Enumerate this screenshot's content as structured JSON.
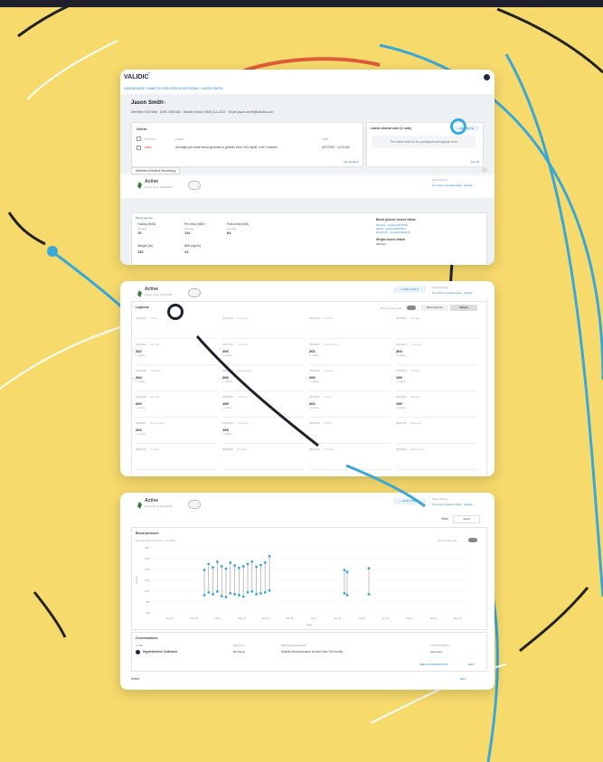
{
  "app": {
    "logo": "VALIDIC",
    "breadcrumb": "DASHBOARD  /  DIABETES-RELATED MONITORING  /  JASON SMITH"
  },
  "patient": {
    "name": "Jason Smith",
    "details": "Identifier 0007698  ·  DOB 3/5/1960  ·  Mobile phone (555) 111-2222  ·  Email jason.smith@validic.com"
  },
  "alerts": {
    "title": "Alerts",
    "col_status": "STATUS",
    "col_alert": "ALERT",
    "col_time": "TIME",
    "row_badge": "HIGH",
    "row_text": "Average pre-meal blood glucose is greater than 130 mg/dL over 3 weeks",
    "row_time": "4/27/2023 · 10:24 AM",
    "link": "See all alerts"
  },
  "latest_note": {
    "title": "Latest clinical note (1 note)",
    "add_label": "+ ADD NOTE",
    "placeholder": "The latest note for the participant will appear here.",
    "link": "See all"
  },
  "program": {
    "tab": "Diabetes-Related Monitoring",
    "status": "Active",
    "since": "Active since 10/4/2022",
    "data_sharing": "Data sharing",
    "data_sharing_link": "5 months of patient data · change",
    "add_vitals": "+ ADD VITALS",
    "colors": {
      "active": "#2e7d32",
      "accent": "#1f87c7",
      "alert": "#d9534f"
    }
  },
  "glucose": {
    "section": "Blood glucose",
    "fasting_label": "Fasting (4MD)",
    "premeal_label": "Pre-meal (4MD)",
    "postmeal_label": "Post-meal (4MD)",
    "fasting_val": "78",
    "premeal_val": "110",
    "postmeal_val": "84",
    "avg_label": "Average",
    "weight_title": "Weight (lb)",
    "bmi_title": "BMI (kg/m²)",
    "weight_val": "152",
    "bmi_val": "24",
    "source_title": "Blood glucose source status",
    "source_1": "Dexcom  ·  synced 4/27/2023",
    "source_2": "Abbott  ·  synced 4/25/2023",
    "source_3": "OneTouch  ·  synced 4/22/2023",
    "weight_source_title": "Weight source status",
    "weight_source": "Withings"
  },
  "logbook": {
    "title": "Logbook",
    "toggle_label": "Out of range only",
    "btn_1": "Blood glucose",
    "btn_2": "Weight",
    "days": [
      {
        "date": "04/12/23",
        "day": "Friday",
        "val": "",
        "note": ""
      },
      {
        "date": "04/13/23",
        "day": "Saturday",
        "val": "",
        "note": ""
      },
      {
        "date": "04/14/23",
        "day": "Sunday",
        "val": "",
        "note": ""
      },
      {
        "date": "04/15/23",
        "day": "Monday",
        "val": "",
        "note": ""
      },
      {
        "date": "04/16/23",
        "day": "Monday",
        "val": "202",
        "note": "1 reading"
      },
      {
        "date": "04/17/23",
        "day": "Tuesday",
        "val": "206",
        "note": "1 reading"
      },
      {
        "date": "04/18/23",
        "day": "Wednesday",
        "val": "201",
        "note": "1 reading"
      },
      {
        "date": "04/19/23",
        "day": "Thursday",
        "val": "203",
        "note": "1 reading"
      },
      {
        "date": "04/20/23",
        "day": "Thursday",
        "val": "202",
        "note": "1 reading"
      },
      {
        "date": "04/21/23",
        "day": "Wednesday",
        "val": "206",
        "note": "1 reading"
      },
      {
        "date": "04/22/23",
        "day": "Tuesday",
        "val": "200",
        "note": "1 reading"
      },
      {
        "date": "04/23/23",
        "day": "Sunday",
        "val": "199",
        "note": "1 reading"
      },
      {
        "date": "04/24/23",
        "day": "Monday",
        "val": "200",
        "note": "1 reading"
      },
      {
        "date": "04/25/23",
        "day": "Tuesday",
        "val": "199",
        "note": "1 reading"
      },
      {
        "date": "04/26/23",
        "day": "Friday",
        "val": "202",
        "note": "1 reading"
      },
      {
        "date": "04/27/23",
        "day": "Monday",
        "val": "199",
        "note": "1 reading"
      },
      {
        "date": "04/28/23",
        "day": "Wednesday",
        "val": "202",
        "note": "1 reading"
      },
      {
        "date": "04/29/23",
        "day": "Thursday",
        "val": "199",
        "note": "1 reading"
      },
      {
        "date": "04/30/23",
        "day": "Friday",
        "val": "",
        "note": ""
      },
      {
        "date": "05/01/23",
        "day": "Saturday",
        "val": "",
        "note": ""
      },
      {
        "date": "05/02/23",
        "day": "Sunday",
        "val": "",
        "note": ""
      },
      {
        "date": "05/03/23",
        "day": "Monday",
        "val": "",
        "note": ""
      },
      {
        "date": "05/04/23",
        "day": "Tuesday",
        "val": "",
        "note": ""
      },
      {
        "date": "05/05/23",
        "day": "Wednesday",
        "val": "",
        "note": ""
      }
    ]
  },
  "bp": {
    "view_label": "View",
    "chart_btn": "Chart",
    "section": "Blood pressure",
    "subtitle": "Morning blood pressure — trending",
    "toggle_label": "Out of range only",
    "ylabel": "mmHg",
    "xlabel": "Date",
    "yticks": [
      "180",
      "160",
      "140",
      "120",
      "100",
      "80",
      "60"
    ],
    "xticks": [
      "Feb 21",
      "Feb 28",
      "Mar 7",
      "Mar 14",
      "Mar 21",
      "Mar 28",
      "Apr 4",
      "Apr 11",
      "Apr 18",
      "Apr 25",
      "May 2",
      "May 9",
      "May 16"
    ],
    "conversations_title": "Conversations",
    "conv_col_1": "NAME",
    "conv_col_2": "REASON",
    "conv_col_3": "MESSAGE PREVIEW",
    "conv_col_4": "ACTION TAKEN",
    "conv_name": "Hypertensive Outreach",
    "conv_reason": "BP Rising",
    "conv_message": "Systolic blood pressure is more than 130 mmHg",
    "conv_action": "Approved",
    "conv_link": "SEE CONVERSATION ›",
    "conv_edit": "EDIT",
    "footer_label": "Notes",
    "footer_edit": "EDIT"
  },
  "chart_data": {
    "type": "scatter",
    "title": "Blood pressure",
    "ylabel": "mmHg",
    "xlabel": "Date",
    "ylim": [
      50,
      190
    ],
    "x": [
      "Mar 8",
      "Mar 10",
      "Mar 12",
      "Mar 14",
      "Mar 16",
      "Mar 18",
      "Mar 20",
      "Mar 22",
      "Mar 24",
      "Mar 26",
      "Mar 28",
      "Mar 30",
      "Apr 1",
      "Apr 3",
      "Apr 5",
      "Apr 7",
      "May 2",
      "May 4",
      "May 10"
    ],
    "series": [
      {
        "name": "Systolic",
        "values": [
          142,
          155,
          148,
          160,
          150,
          145,
          158,
          152,
          147,
          150,
          155,
          160,
          149,
          153,
          158,
          172,
          142,
          138,
          146
        ]
      },
      {
        "name": "Diastolic",
        "values": [
          88,
          94,
          90,
          96,
          86,
          84,
          92,
          90,
          88,
          85,
          94,
          96,
          90,
          92,
          94,
          98,
          92,
          88,
          90
        ]
      }
    ]
  }
}
